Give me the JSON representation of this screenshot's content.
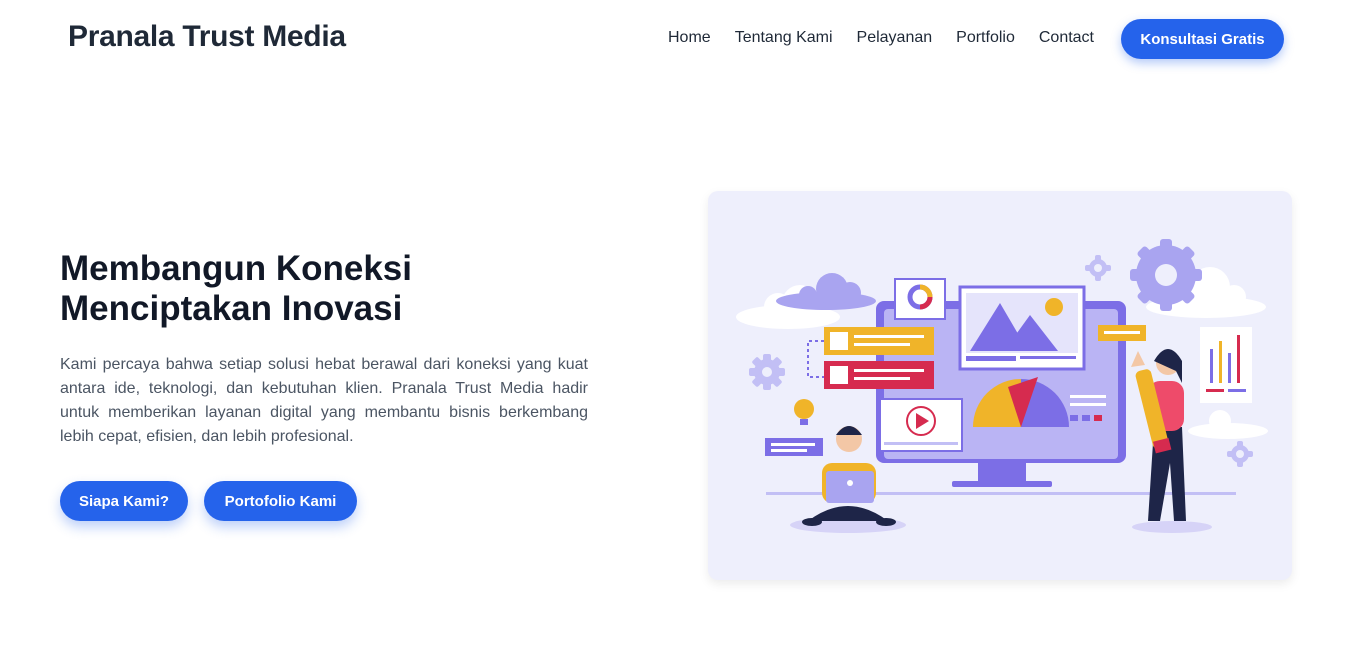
{
  "header": {
    "brand": "Pranala Trust Media",
    "nav": [
      "Home",
      "Tentang Kami",
      "Pelayanan",
      "Portfolio",
      "Contact"
    ],
    "cta_label": "Konsultasi Gratis"
  },
  "hero": {
    "title_line1": "Membangun Koneksi",
    "title_line2": "Menciptakan Inovasi",
    "description": "Kami percaya bahwa setiap solusi hebat berawal dari koneksi yang kuat antara ide, teknologi, dan kebutuhan klien. Pranala Trust Media hadir untuk memberikan layanan digital yang membantu bisnis berkembang lebih cepat, efisien, dan lebih profesional.",
    "button_about": "Siapa Kami?",
    "button_portfolio": "Portofolio Kami"
  },
  "colors": {
    "accent": "#2563eb",
    "illustration_bg": "#eeeffc",
    "purple": "#7c6ee6",
    "yellow": "#f0b429",
    "red": "#d62b4f"
  }
}
